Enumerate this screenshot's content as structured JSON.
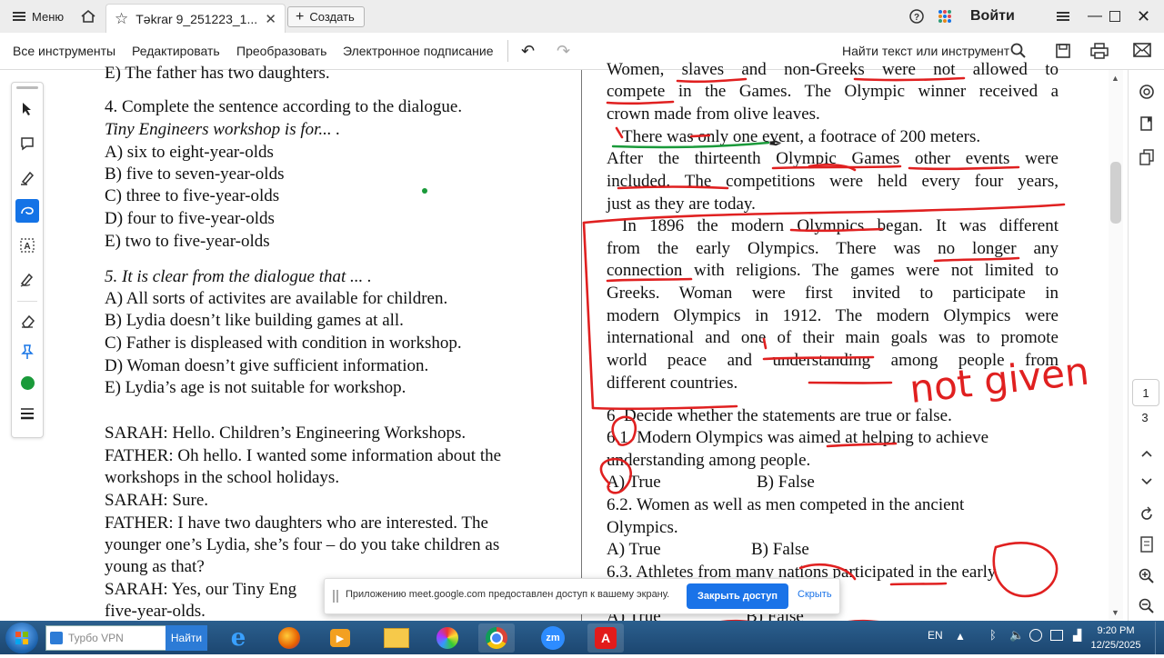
{
  "titlebar": {
    "menu_label": "Меню",
    "tab_title": "Təkrar 9_251223_1...",
    "create_label": "Создать",
    "signin_label": "Войти"
  },
  "toolbar": {
    "menus": [
      "Все инструменты",
      "Редактировать",
      "Преобразовать",
      "Электронное подписание"
    ],
    "search_label": "Найти текст или инструмент"
  },
  "document": {
    "left_lines": [
      "E) The father has two daughters.",
      "4. Complete the sentence according to the dialogue.",
      "Tiny Engineers workshop is for... .",
      "A) six to eight-year-olds",
      "B) five to seven-year-olds",
      "C) three to five-year-olds",
      "D) four to five-year-olds",
      "E) two to five-year-olds",
      "5. It is clear from the dialogue that ... .",
      "A) All sorts of activites are available for children.",
      "B) Lydia doesn’t like building games at all.",
      "C) Father is displeased with condition in workshop.",
      "D) Woman doesn’t give sufficient information.",
      "E) Lydia’s age is not suitable for workshop.",
      "SARAH: Hello. Children’s Engineering Workshops.",
      "FATHER: Oh hello. I wanted some information about the",
      "workshops in the school holidays.",
      "SARAH: Sure.",
      "FATHER: I have two daughters who are interested. The",
      "younger one’s Lydia, she’s four – do you take children as",
      "young as that?",
      "SARAH: Yes, our Tiny Eng",
      "five-year-olds."
    ],
    "right_lines": [
      "Women, slaves and non-Greeks were not allowed to",
      "compete in the Games. The Olympic winner received a",
      "crown made from olive leaves.",
      "There was only one event, a footrace of 200 meters.",
      "After the thirteenth Olympic Games other events were",
      "included. The competitions were held every four years,",
      "just as they are today.",
      "In 1896 the modern Olympics began. It was different",
      "from the early Olympics. There was no longer any",
      "connection with religions. The games were not limited to",
      "Greeks. Woman were first invited to participate in",
      "modern Olympics in 1912. The modern Olympics were",
      "international and one of their main goals was to promote",
      "world peace and understanding among people from",
      "different countries.",
      "6. Decide whether the statements are true or false.",
      "6.1. Modern Olympics was aimed at helping to achieve",
      "understanding among people.",
      "A) True",
      "B) False",
      "6.2. Women as well as men competed in the ancient",
      "Olympics.",
      "A) True",
      "B) False",
      "6.3. Athletes from many nations participated in the early",
      "A) True",
      "B) False"
    ],
    "handwriting": "not given"
  },
  "pages": {
    "current": "1",
    "total": "3"
  },
  "notification": {
    "text": "Приложению meet.google.com предоставлен доступ к вашему экрану.",
    "stop_label": "Закрыть доступ",
    "hide_label": "Скрыть"
  },
  "taskbar": {
    "search_placeholder": "Турбо VPN",
    "search_button": "Найти",
    "lang": "EN",
    "time": "9:20 PM",
    "date": "12/25/2025"
  },
  "colors": {
    "accent": "#1473e6",
    "annotation_red": "#e02020",
    "annotation_green": "#1a9a3a",
    "taskbar": "#1f4c78"
  }
}
